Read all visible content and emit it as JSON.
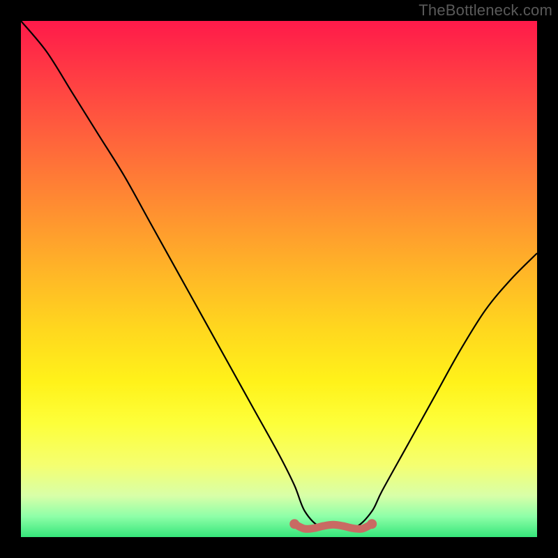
{
  "watermark": "TheBottleneck.com",
  "chart_data": {
    "type": "line",
    "title": "",
    "xlabel": "",
    "ylabel": "",
    "xlim": [
      0,
      100
    ],
    "ylim": [
      0,
      100
    ],
    "series": [
      {
        "name": "bottleneck-curve",
        "x": [
          0,
          5,
          10,
          15,
          20,
          25,
          30,
          35,
          40,
          45,
          50,
          53,
          55,
          58,
          62,
          65,
          68,
          70,
          75,
          80,
          85,
          90,
          95,
          100
        ],
        "values": [
          100,
          94,
          86,
          78,
          70,
          61,
          52,
          43,
          34,
          25,
          16,
          10,
          5,
          2,
          2,
          2,
          5,
          9,
          18,
          27,
          36,
          44,
          50,
          55
        ]
      }
    ],
    "annotations": [
      {
        "name": "flat-bottom-marker",
        "x_range": [
          53,
          68
        ],
        "y": 2,
        "color": "#c96a63"
      }
    ],
    "gradient_stops": [
      {
        "pos": 0,
        "color": "#ff1a4a"
      },
      {
        "pos": 50,
        "color": "#ffba26"
      },
      {
        "pos": 80,
        "color": "#fdff3a"
      },
      {
        "pos": 100,
        "color": "#35e67a"
      }
    ]
  }
}
